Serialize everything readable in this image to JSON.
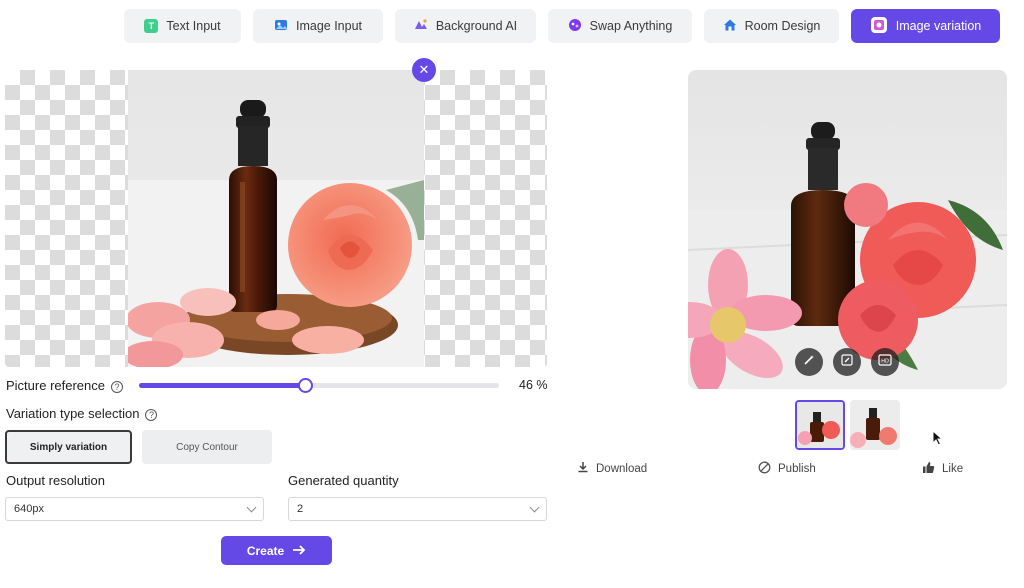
{
  "tabs": [
    {
      "label": "Text Input",
      "icon": "text-icon",
      "active": false
    },
    {
      "label": "Image Input",
      "icon": "image-icon",
      "active": false
    },
    {
      "label": "Background AI",
      "icon": "background-icon",
      "active": false
    },
    {
      "label": "Swap Anything",
      "icon": "swap-icon",
      "active": false
    },
    {
      "label": "Room Design",
      "icon": "house-icon",
      "active": false
    },
    {
      "label": "Image variation",
      "icon": "variation-icon",
      "active": true
    }
  ],
  "reference": {
    "label": "Picture reference",
    "value_text": "46 %",
    "value": 0.46
  },
  "variation": {
    "label": "Variation type selection",
    "options": [
      "Simply variation",
      "Copy Contour"
    ],
    "selected": "Simply variation"
  },
  "resolution": {
    "label": "Output resolution",
    "value": "640px"
  },
  "quantity": {
    "label": "Generated quantity",
    "value": "2"
  },
  "create_label": "Create",
  "actions": {
    "download": "Download",
    "publish": "Publish",
    "like": "Like"
  },
  "colors": {
    "accent": "#6449e6"
  }
}
